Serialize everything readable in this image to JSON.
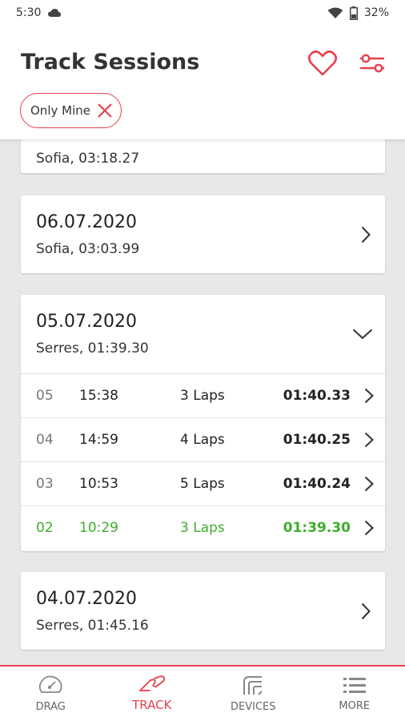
{
  "status": {
    "time": "5:30",
    "battery": "32%"
  },
  "header": {
    "title": "Track Sessions",
    "filter_chip": "Only Mine"
  },
  "sessions": [
    {
      "date": "",
      "sub": "Sofia, 03:18.27"
    },
    {
      "date": "06.07.2020",
      "sub": "Sofia, 03:03.99"
    },
    {
      "date": "05.07.2020",
      "sub": "Serres, 01:39.30",
      "laps": [
        {
          "num": "05",
          "time": "15:38",
          "laps": "3 Laps",
          "best": "01:40.33"
        },
        {
          "num": "04",
          "time": "14:59",
          "laps": "4 Laps",
          "best": "01:40.25"
        },
        {
          "num": "03",
          "time": "10:53",
          "laps": "5 Laps",
          "best": "01:40.24"
        },
        {
          "num": "02",
          "time": "10:29",
          "laps": "3 Laps",
          "best": "01:39.30"
        }
      ]
    },
    {
      "date": "04.07.2020",
      "sub": "Serres, 01:45.16"
    }
  ],
  "nav": [
    {
      "label": "DRAG",
      "icon": "gauge-icon"
    },
    {
      "label": "TRACK",
      "icon": "track-icon"
    },
    {
      "label": "DEVICES",
      "icon": "device-icon"
    },
    {
      "label": "MORE",
      "icon": "menu-icon"
    }
  ],
  "colors": {
    "accent": "#e8404e",
    "best": "#3fad2e"
  }
}
